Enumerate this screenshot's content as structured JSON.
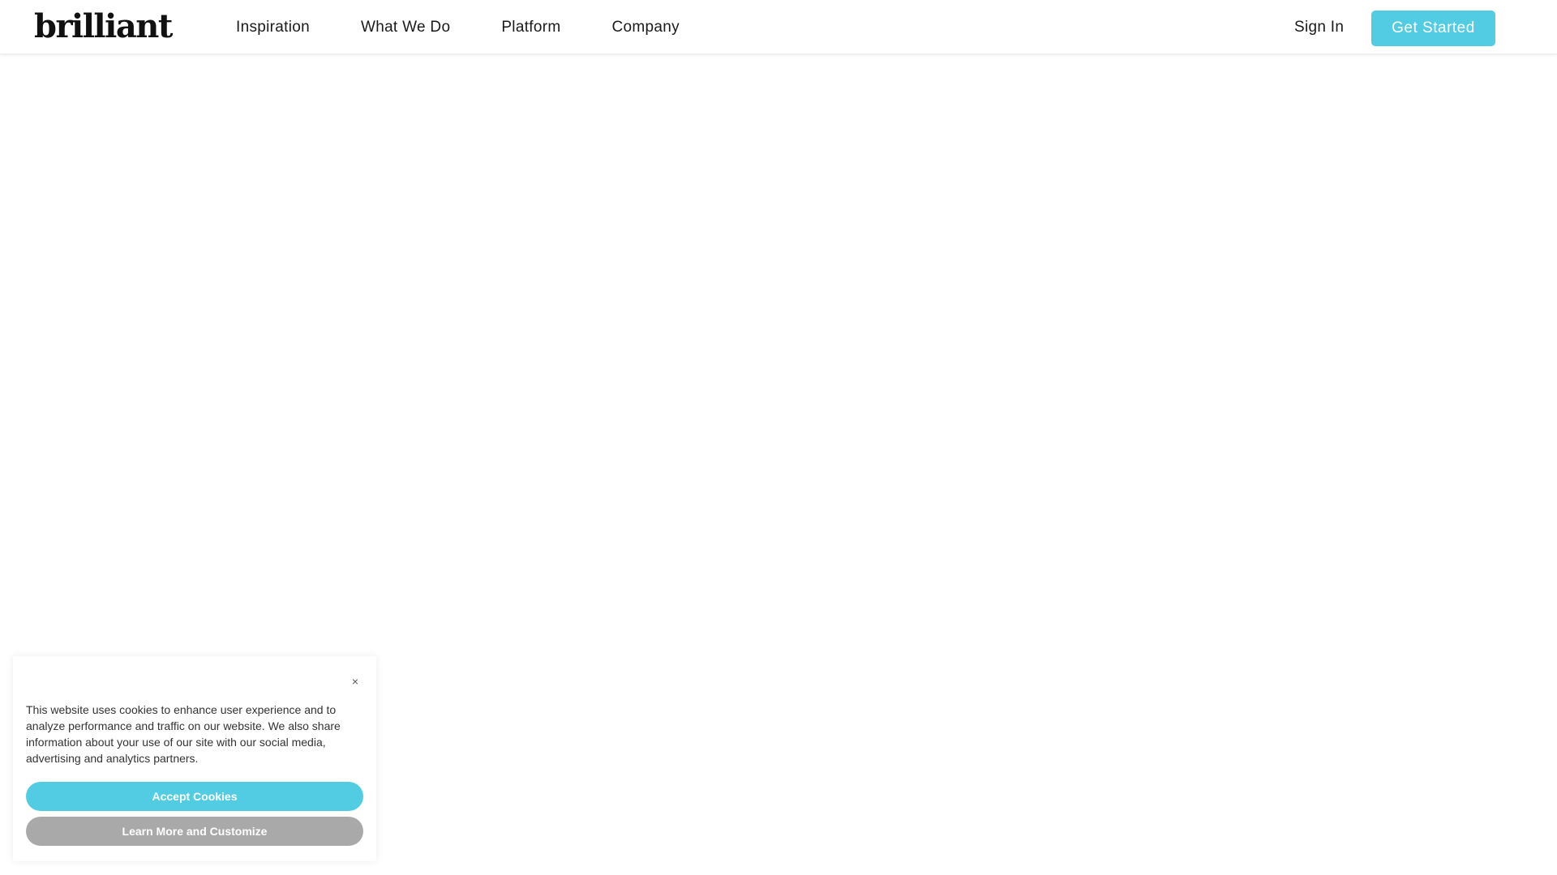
{
  "colors": {
    "accent": "#52cce3",
    "secondary_button": "#a9a9a9"
  },
  "header": {
    "logo": "brilliant",
    "nav": [
      {
        "label": "Inspiration"
      },
      {
        "label": "What We Do"
      },
      {
        "label": "Platform"
      },
      {
        "label": "Company"
      }
    ],
    "sign_in": "Sign In",
    "get_started": "Get Started"
  },
  "cookie_banner": {
    "close_icon": "×",
    "text": "This website uses cookies to enhance user experience and to analyze performance and traffic on our website. We also share information about your use of our site with our social media, advertising and analytics partners.",
    "accept_label": "Accept Cookies",
    "learn_label": "Learn More and Customize"
  }
}
